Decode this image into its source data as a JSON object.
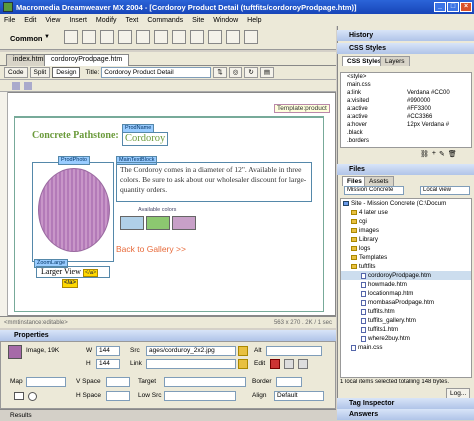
{
  "window": {
    "title": "Macromedia Dreamweaver MX 2004 - [Cordoroy Product Detail (tuftfits/cordoroyProdpage.htm)]"
  },
  "menu": [
    "File",
    "Edit",
    "View",
    "Insert",
    "Modify",
    "Text",
    "Commands",
    "Site",
    "Window",
    "Help"
  ],
  "insert_bar": {
    "category": "Common"
  },
  "document": {
    "tabs": [
      "index.html",
      "cordoroyProdpage.htm"
    ],
    "toolbar": {
      "code": "Code",
      "split": "Split",
      "design": "Design",
      "title_label": "Title:",
      "title_value": "Cordoroy Product Detail"
    },
    "template_label": "Template:product",
    "heading": "Concrete Pathstone:",
    "fabric_region": "ProdName",
    "fabric_name": "Cordoroy",
    "photo_region": "ProdPhoto",
    "text_region": "MainTextBlock",
    "description": "The Cordoroy comes in a diameter of 12\". Available in three colors. Be sure to ask about our wholesaler discount for large-quantity orders.",
    "available_colors": "Available colors",
    "back_link": "Back to Gallery >>",
    "zoom_region": "ZoomLarge",
    "larger_view": "Larger View",
    "a_tag": "</a>",
    "status_tags": "<mmtinstance:editable>",
    "status_size": "563 x 270 . 2K / 1 sec"
  },
  "properties": {
    "header": "Properties",
    "image_label": "Image, 19K",
    "w_label": "W",
    "w_value": "144",
    "h_label": "H",
    "h_value": "144",
    "src_label": "Src",
    "src_value": "ages/corduroy_2x2.jpg",
    "link_label": "Link",
    "alt_label": "Alt",
    "edit_label": "Edit",
    "map_label": "Map",
    "vspace_label": "V Space",
    "hspace_label": "H Space",
    "target_label": "Target",
    "lowsrc_label": "Low Src",
    "border_label": "Border",
    "align_label": "Align",
    "align_value": "Default"
  },
  "results_bar": "Results",
  "panels": {
    "history": "History",
    "css_styles": "CSS Styles",
    "css_tabs": [
      "CSS Styles",
      "Layers"
    ],
    "css_rules": [
      {
        "sel": "<style>",
        "val": ""
      },
      {
        "sel": "main.css",
        "val": ""
      },
      {
        "sel": "a:link",
        "val": "Verdana #CC00"
      },
      {
        "sel": "a:visited",
        "val": "#990000"
      },
      {
        "sel": "a:active",
        "val": "#FF3300"
      },
      {
        "sel": "a:active",
        "val": "#CC3366"
      },
      {
        "sel": "a:hover",
        "val": "12px Verdana #"
      },
      {
        "sel": ".black",
        "val": ""
      },
      {
        "sel": ".borders",
        "val": ""
      }
    ],
    "files": "Files",
    "files_tabs": [
      "Files",
      "Assets"
    ],
    "site_select": "Mission Concrete",
    "view_select": "Local view",
    "file_tree": [
      {
        "name": "Site - Mission Concrete (C:\\Docum",
        "type": "site",
        "indent": 0
      },
      {
        "name": "4 later use",
        "type": "folder",
        "indent": 1
      },
      {
        "name": "cgi",
        "type": "folder",
        "indent": 1
      },
      {
        "name": "images",
        "type": "folder",
        "indent": 1
      },
      {
        "name": "Library",
        "type": "folder",
        "indent": 1
      },
      {
        "name": "logs",
        "type": "folder",
        "indent": 1
      },
      {
        "name": "Templates",
        "type": "folder",
        "indent": 1
      },
      {
        "name": "tuftfits",
        "type": "folder",
        "indent": 1
      },
      {
        "name": "cordoroyProdpage.htm",
        "type": "file",
        "indent": 2
      },
      {
        "name": "howmade.htm",
        "type": "file",
        "indent": 2
      },
      {
        "name": "locationmap.htm",
        "type": "file",
        "indent": 2
      },
      {
        "name": "mombasaProdpage.htm",
        "type": "file",
        "indent": 2
      },
      {
        "name": "tuffits.htm",
        "type": "file",
        "indent": 2
      },
      {
        "name": "tuffits_gallery.htm",
        "type": "file",
        "indent": 2
      },
      {
        "name": "tuffits1.htm",
        "type": "file",
        "indent": 2
      },
      {
        "name": "where2buy.htm",
        "type": "file",
        "indent": 2
      },
      {
        "name": "main.css",
        "type": "file",
        "indent": 1
      }
    ],
    "files_status": "1 local items selected totalling 148 bytes.",
    "log_button": "Log...",
    "tag_inspector": "Tag Inspector",
    "answers": "Answers"
  },
  "colors": {
    "swatch1": "#b0d0e8",
    "swatch2": "#8cc870",
    "swatch3": "#c8a0c8",
    "heading": "#6a9a3a",
    "link": "#e86a3a"
  }
}
